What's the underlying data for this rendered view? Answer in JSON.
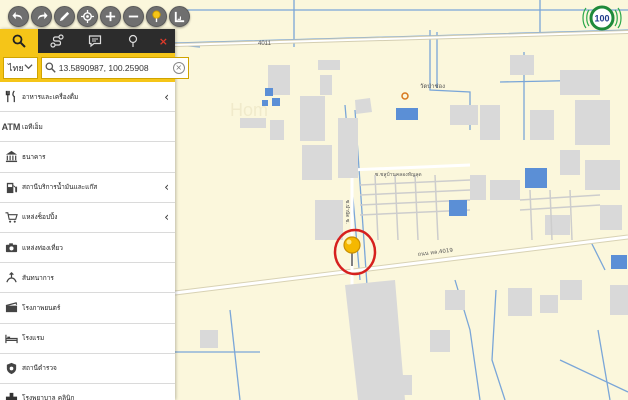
{
  "toolbar": {
    "buttons": [
      {
        "name": "back-icon"
      },
      {
        "name": "forward-icon"
      },
      {
        "name": "draw-pencil-icon"
      },
      {
        "name": "locate-target-icon"
      },
      {
        "name": "zoom-in-icon"
      },
      {
        "name": "zoom-out-icon"
      },
      {
        "name": "place-marker-icon"
      },
      {
        "name": "measure-ruler-icon"
      }
    ]
  },
  "panel": {
    "tabs": [
      {
        "name": "search-icon",
        "active": true
      },
      {
        "name": "route-icon",
        "active": false
      },
      {
        "name": "comment-icon",
        "active": false
      },
      {
        "name": "marker-icon",
        "active": false
      }
    ],
    "close_label": "×",
    "language": "ไทย",
    "search_value": "13.5890987, 100.25908",
    "categories": [
      {
        "icon": "restaurant-icon",
        "label": "อาหารและเครื่องดื่ม",
        "has_submenu": true
      },
      {
        "icon_text": "ATM",
        "label": "เอทีเอ็ม",
        "has_submenu": false
      },
      {
        "icon": "bank-icon",
        "label": "ธนาคาร",
        "has_submenu": false
      },
      {
        "icon": "gas-station-icon",
        "label": "สถานีบริการน้ำมันและแก๊ส",
        "has_submenu": true
      },
      {
        "icon": "shopping-cart-icon",
        "label": "แหล่งช็อปปิ้ง",
        "has_submenu": true
      },
      {
        "icon": "camera-icon",
        "label": "แหล่งท่องเที่ยว",
        "has_submenu": false
      },
      {
        "icon": "recreation-icon",
        "label": "สันทนาการ",
        "has_submenu": false
      },
      {
        "icon": "cinema-icon",
        "label": "โรงภาพยนตร์",
        "has_submenu": false
      },
      {
        "icon": "hotel-bed-icon",
        "label": "โรงแรม",
        "has_submenu": false
      },
      {
        "icon": "police-icon",
        "label": "สถานีตำรวจ",
        "has_submenu": false
      },
      {
        "icon": "hospital-icon",
        "label": "โรงพยาบาล คลินิก",
        "has_submenu": false
      }
    ]
  },
  "map": {
    "road_number_top": "4011",
    "road_label_main": "ถนน ทล.4019",
    "road_label_soi": "ซ.ชลูบ้านคลองทัญลุด",
    "road_label_soi_vertical": "ซ.บำบัด ซ.",
    "poi_label": "วัดป่าช่อง",
    "watermark": "Hom",
    "pin_color": "#f5b800",
    "highlight_color": "#d6201e"
  },
  "brand": {
    "label": "100",
    "ring_color": "#1f8a3a"
  }
}
